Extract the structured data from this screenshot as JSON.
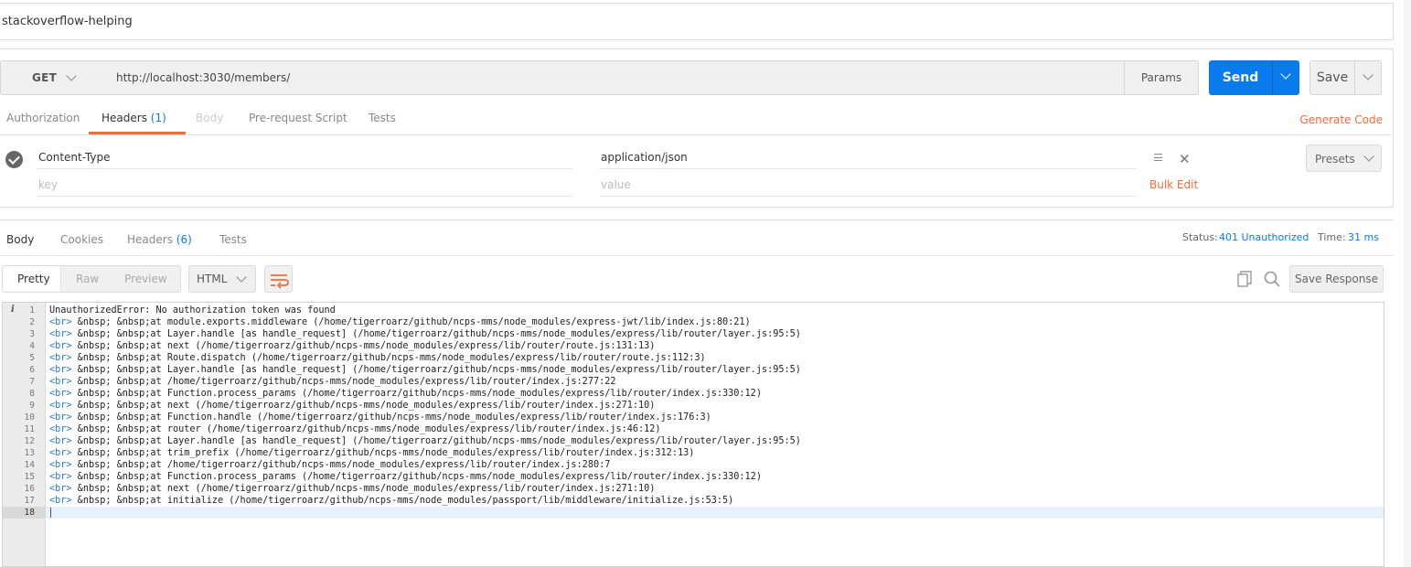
{
  "collection_title": "stackoverflow-helping",
  "request": {
    "method": "GET",
    "url": "http://localhost:3030/members/",
    "params_label": "Params",
    "send_label": "Send",
    "save_label": "Save"
  },
  "request_tabs": {
    "authorization": "Authorization",
    "headers": "Headers",
    "headers_count": "(1)",
    "body": "Body",
    "pre_request": "Pre-request Script",
    "tests": "Tests",
    "generate_code": "Generate Code"
  },
  "headers": {
    "rows": [
      {
        "key": "Content-Type",
        "value": "application/json"
      }
    ],
    "key_placeholder": "key",
    "value_placeholder": "value",
    "bulk_edit": "Bulk Edit",
    "presets": "Presets"
  },
  "response_tabs": {
    "body": "Body",
    "cookies": "Cookies",
    "headers": "Headers",
    "headers_count": "(6)",
    "tests": "Tests"
  },
  "response_status": {
    "status_label": "Status:",
    "status_value": "401 Unauthorized",
    "time_label": "Time:",
    "time_value": "31 ms"
  },
  "response_toolbar": {
    "pretty": "Pretty",
    "raw": "Raw",
    "preview": "Preview",
    "format": "HTML",
    "save_response": "Save Response"
  },
  "response_body": {
    "lines": [
      {
        "n": "1",
        "tag": "",
        "text": "UnauthorizedError: No authorization token was found"
      },
      {
        "n": "2",
        "tag": "<br>",
        "text": " &nbsp; &nbsp;at module.exports.middleware (/home/tigerroarz/github/ncps-mms/node_modules/express-jwt/lib/index.js:80:21)"
      },
      {
        "n": "3",
        "tag": "<br>",
        "text": " &nbsp; &nbsp;at Layer.handle [as handle_request] (/home/tigerroarz/github/ncps-mms/node_modules/express/lib/router/layer.js:95:5)"
      },
      {
        "n": "4",
        "tag": "<br>",
        "text": " &nbsp; &nbsp;at next (/home/tigerroarz/github/ncps-mms/node_modules/express/lib/router/route.js:131:13)"
      },
      {
        "n": "5",
        "tag": "<br>",
        "text": " &nbsp; &nbsp;at Route.dispatch (/home/tigerroarz/github/ncps-mms/node_modules/express/lib/router/route.js:112:3)"
      },
      {
        "n": "6",
        "tag": "<br>",
        "text": " &nbsp; &nbsp;at Layer.handle [as handle_request] (/home/tigerroarz/github/ncps-mms/node_modules/express/lib/router/layer.js:95:5)"
      },
      {
        "n": "7",
        "tag": "<br>",
        "text": " &nbsp; &nbsp;at /home/tigerroarz/github/ncps-mms/node_modules/express/lib/router/index.js:277:22"
      },
      {
        "n": "8",
        "tag": "<br>",
        "text": " &nbsp; &nbsp;at Function.process_params (/home/tigerroarz/github/ncps-mms/node_modules/express/lib/router/index.js:330:12)"
      },
      {
        "n": "9",
        "tag": "<br>",
        "text": " &nbsp; &nbsp;at next (/home/tigerroarz/github/ncps-mms/node_modules/express/lib/router/index.js:271:10)"
      },
      {
        "n": "10",
        "tag": "<br>",
        "text": " &nbsp; &nbsp;at Function.handle (/home/tigerroarz/github/ncps-mms/node_modules/express/lib/router/index.js:176:3)"
      },
      {
        "n": "11",
        "tag": "<br>",
        "text": " &nbsp; &nbsp;at router (/home/tigerroarz/github/ncps-mms/node_modules/express/lib/router/index.js:46:12)"
      },
      {
        "n": "12",
        "tag": "<br>",
        "text": " &nbsp; &nbsp;at Layer.handle [as handle_request] (/home/tigerroarz/github/ncps-mms/node_modules/express/lib/router/layer.js:95:5)"
      },
      {
        "n": "13",
        "tag": "<br>",
        "text": " &nbsp; &nbsp;at trim_prefix (/home/tigerroarz/github/ncps-mms/node_modules/express/lib/router/index.js:312:13)"
      },
      {
        "n": "14",
        "tag": "<br>",
        "text": " &nbsp; &nbsp;at /home/tigerroarz/github/ncps-mms/node_modules/express/lib/router/index.js:280:7"
      },
      {
        "n": "15",
        "tag": "<br>",
        "text": " &nbsp; &nbsp;at Function.process_params (/home/tigerroarz/github/ncps-mms/node_modules/express/lib/router/index.js:330:12)"
      },
      {
        "n": "16",
        "tag": "<br>",
        "text": " &nbsp; &nbsp;at next (/home/tigerroarz/github/ncps-mms/node_modules/express/lib/router/index.js:271:10)"
      },
      {
        "n": "17",
        "tag": "<br>",
        "text": " &nbsp; &nbsp;at initialize (/home/tigerroarz/github/ncps-mms/node_modules/passport/lib/middleware/initialize.js:53:5)"
      },
      {
        "n": "18",
        "tag": "",
        "text": ""
      }
    ],
    "current_line": 18
  },
  "colors": {
    "accent": "#f26b3a",
    "send": "#097bed",
    "link": "#097bed"
  },
  "icons": {
    "method_dropdown": "chevron-down-icon",
    "send_dropdown": "chevron-down-icon",
    "save_dropdown": "chevron-down-icon",
    "header_enabled": "check-circle-icon",
    "header_menu": "hamburger-icon",
    "header_delete": "close-icon",
    "wrap": "wrap-lines-icon",
    "copy": "copy-icon",
    "search": "search-icon",
    "info": "info-icon"
  }
}
